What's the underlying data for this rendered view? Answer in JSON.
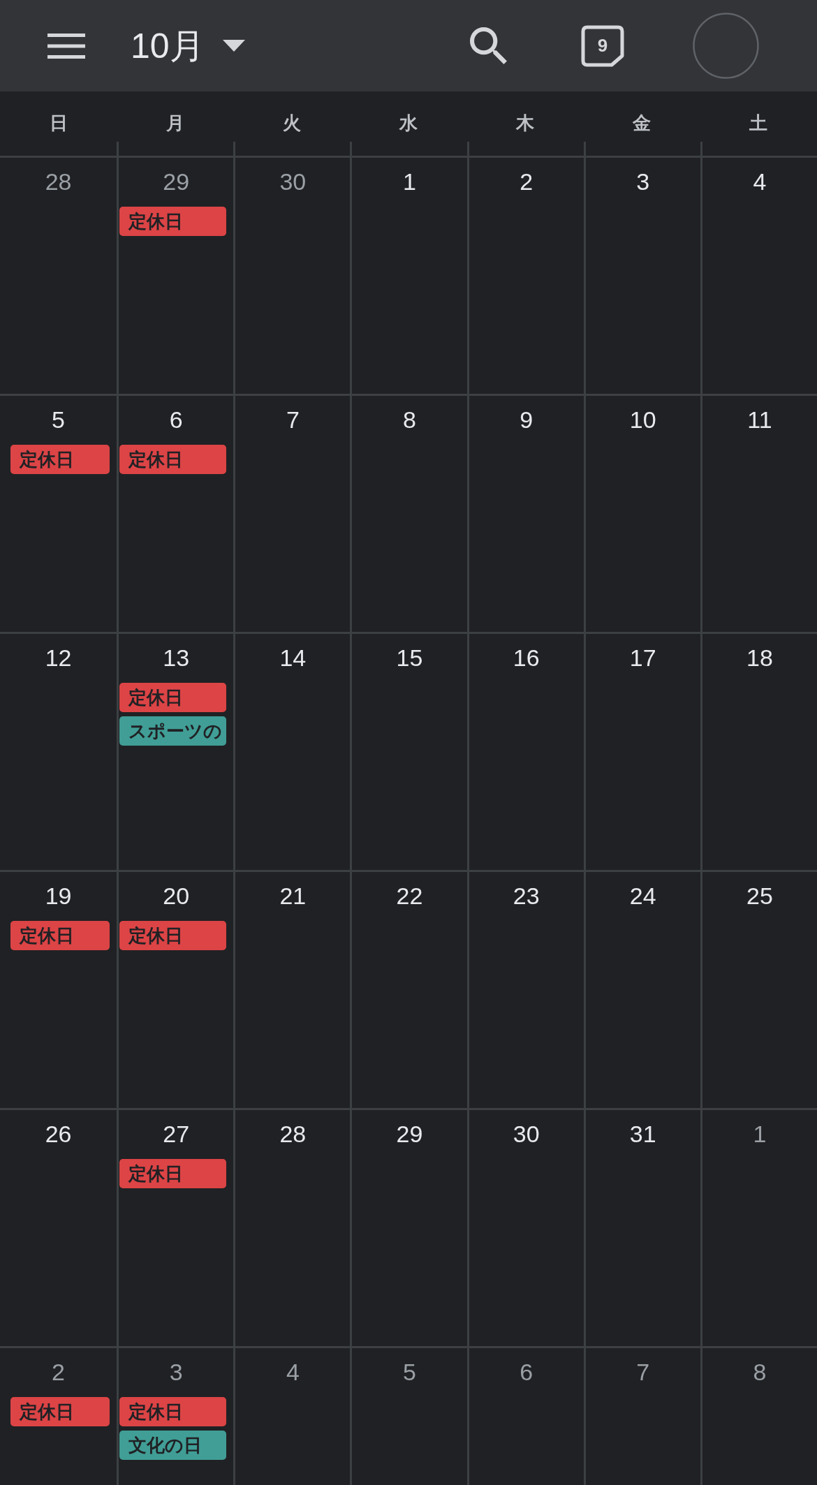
{
  "top_bar": {
    "month_title": "10月",
    "today_date": "9"
  },
  "weekdays": [
    "日",
    "月",
    "火",
    "水",
    "木",
    "金",
    "土"
  ],
  "weeks": [
    {
      "days": [
        {
          "date": "28",
          "other_month": true
        },
        {
          "date": "29",
          "other_month": true,
          "events": [
            {
              "title": "定休日",
              "color": "#dc4446"
            }
          ]
        },
        {
          "date": "30",
          "other_month": true
        },
        {
          "date": "1",
          "other_month": false
        },
        {
          "date": "2",
          "other_month": false
        },
        {
          "date": "3",
          "other_month": false
        },
        {
          "date": "4",
          "other_month": false
        }
      ]
    },
    {
      "days": [
        {
          "date": "5",
          "other_month": false,
          "events": [
            {
              "title": "定休日",
              "color": "#dc4446"
            }
          ]
        },
        {
          "date": "6",
          "other_month": false,
          "events": [
            {
              "title": "定休日",
              "color": "#dc4446"
            }
          ]
        },
        {
          "date": "7",
          "other_month": false
        },
        {
          "date": "8",
          "other_month": false
        },
        {
          "date": "9",
          "other_month": false
        },
        {
          "date": "10",
          "other_month": false
        },
        {
          "date": "11",
          "other_month": false
        }
      ]
    },
    {
      "days": [
        {
          "date": "12",
          "other_month": false
        },
        {
          "date": "13",
          "other_month": false,
          "events": [
            {
              "title": "定休日",
              "color": "#dc4446"
            },
            {
              "title": "スポーツの",
              "color": "#409e96"
            }
          ]
        },
        {
          "date": "14",
          "other_month": false
        },
        {
          "date": "15",
          "other_month": false
        },
        {
          "date": "16",
          "other_month": false
        },
        {
          "date": "17",
          "other_month": false
        },
        {
          "date": "18",
          "other_month": false
        }
      ]
    },
    {
      "days": [
        {
          "date": "19",
          "other_month": false,
          "events": [
            {
              "title": "定休日",
              "color": "#dc4446"
            }
          ]
        },
        {
          "date": "20",
          "other_month": false,
          "events": [
            {
              "title": "定休日",
              "color": "#dc4446"
            }
          ]
        },
        {
          "date": "21",
          "other_month": false
        },
        {
          "date": "22",
          "other_month": false
        },
        {
          "date": "23",
          "other_month": false
        },
        {
          "date": "24",
          "other_month": false
        },
        {
          "date": "25",
          "other_month": false
        }
      ]
    },
    {
      "days": [
        {
          "date": "26",
          "other_month": false
        },
        {
          "date": "27",
          "other_month": false,
          "events": [
            {
              "title": "定休日",
              "color": "#dc4446"
            }
          ]
        },
        {
          "date": "28",
          "other_month": false
        },
        {
          "date": "29",
          "other_month": false
        },
        {
          "date": "30",
          "other_month": false
        },
        {
          "date": "31",
          "other_month": false
        },
        {
          "date": "1",
          "other_month": true
        }
      ]
    },
    {
      "days": [
        {
          "date": "2",
          "other_month": true,
          "events": [
            {
              "title": "定休日",
              "color": "#dc4446"
            }
          ]
        },
        {
          "date": "3",
          "other_month": true,
          "events": [
            {
              "title": "定休日",
              "color": "#dc4446"
            },
            {
              "title": "文化の日",
              "color": "#409e96"
            }
          ]
        },
        {
          "date": "4",
          "other_month": true
        },
        {
          "date": "5",
          "other_month": true
        },
        {
          "date": "6",
          "other_month": true
        },
        {
          "date": "7",
          "other_month": true
        },
        {
          "date": "8",
          "other_month": true
        }
      ]
    }
  ]
}
